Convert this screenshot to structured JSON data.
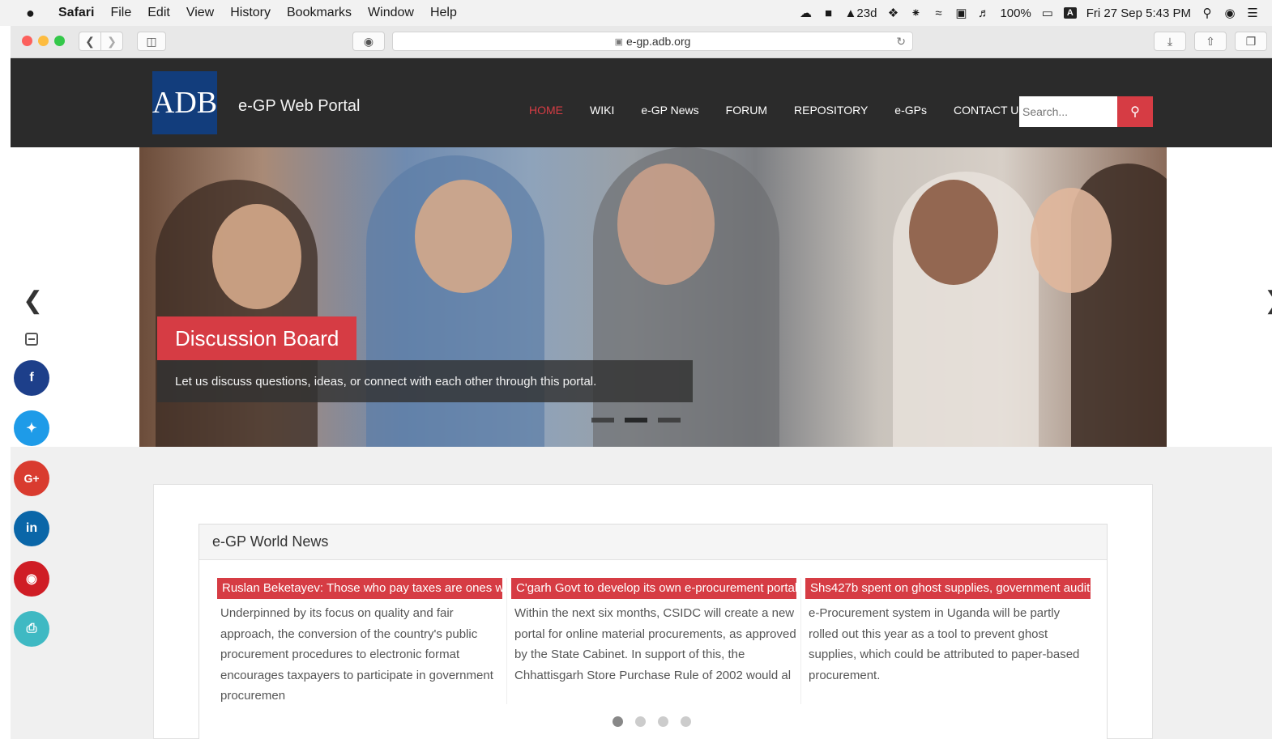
{
  "menubar": {
    "apple": "",
    "items": [
      "Safari",
      "File",
      "Edit",
      "View",
      "History",
      "Bookmarks",
      "Window",
      "Help"
    ],
    "status": {
      "adobe_days": "23d",
      "battery": "100%",
      "input_source": "A",
      "datetime": "Fri 27 Sep  5:43 PM"
    }
  },
  "browser": {
    "url": "e-gp.adb.org"
  },
  "site": {
    "logo_text": "ADB",
    "portal_title": "e-GP Web Portal",
    "nav": [
      "HOME",
      "WIKI",
      "e-GP News",
      "FORUM",
      "REPOSITORY",
      "e-GPs",
      "CONTACT US"
    ],
    "search_placeholder": "Search..."
  },
  "hero": {
    "title": "Discussion Board",
    "caption": "Let us discuss questions, ideas, or connect with each other through this portal."
  },
  "social": {
    "facebook": "f",
    "twitter": "t",
    "googleplus": "G+",
    "linkedin": "in",
    "pinterest": "p",
    "print": "print"
  },
  "news": {
    "heading": "e-GP World News",
    "items": [
      {
        "title": "Ruslan Beketayev: Those who pay taxes are ones who",
        "body": "Underpinned by its focus on quality and fair approach, the conversion of the country's public procurement procedures to electronic format encourages taxpayers to participate in government procuremen"
      },
      {
        "title": "C'garh Govt to develop its own e-procurement portal",
        "body": "Within the next six months, CSIDC will create a new portal for online material procurements, as approved by the State Cabinet. In support of this, the Chhattisgarh Store Purchase Rule of 2002 would al"
      },
      {
        "title": "Shs427b spent on ghost supplies, government audit",
        "body": "e-Procurement system in Uganda will be partly rolled out this year as a tool to prevent ghost supplies, which could be attributed to paper-based procurement."
      }
    ]
  }
}
